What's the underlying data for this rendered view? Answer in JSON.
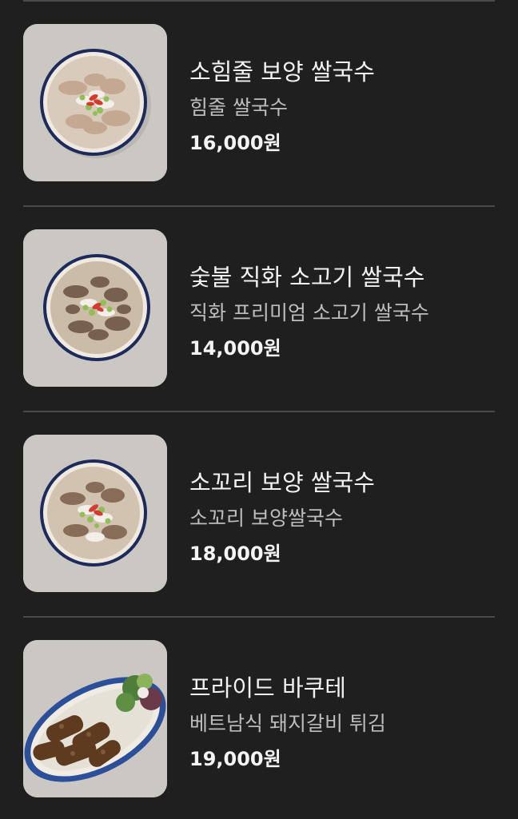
{
  "menu": {
    "items": [
      {
        "name": "소힘줄 보양 쌀국수",
        "description": "힘줄 쌀국수",
        "price": "16,000원",
        "image": "beef-tendon-pho-bowl"
      },
      {
        "name": "숯불 직화 소고기 쌀국수",
        "description": "직화 프리미엄 소고기 쌀국수",
        "price": "14,000원",
        "image": "grilled-beef-pho-bowl"
      },
      {
        "name": "소꼬리 보양 쌀국수",
        "description": "소꼬리 보양쌀국수",
        "price": "18,000원",
        "image": "oxtail-pho-bowl"
      },
      {
        "name": "프라이드 바쿠테",
        "description": "베트남식 돼지갈비 튀김",
        "price": "19,000원",
        "image": "fried-pork-ribs-platter"
      }
    ]
  },
  "colors": {
    "background": "#1f1f1f",
    "divider": "#4a4a4a",
    "name_text": "#f2f2f2",
    "description_text": "#bdbdbd",
    "price_text": "#f4f4f4"
  }
}
